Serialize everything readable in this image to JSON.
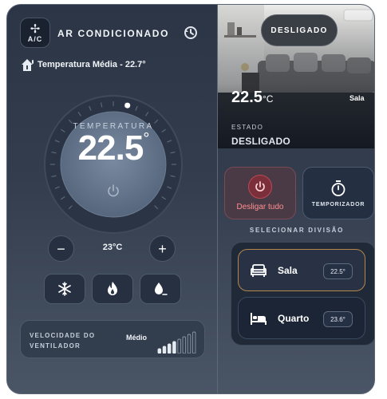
{
  "app": {
    "title": "AR CONDICIONADO",
    "logo_text": "A/C",
    "logo_icon": "fan-icon",
    "history_icon": "history-icon"
  },
  "average": {
    "text": "Temperatura Média - 22.7°",
    "icon": "home-thermometer-icon"
  },
  "dial": {
    "label": "TEMPERATURA",
    "value": "22.5",
    "unit": "°",
    "power_icon": "power-icon",
    "level_fraction": 0.55
  },
  "setpoint": {
    "decrease_label": "−",
    "value": "23°C",
    "increase_label": "+"
  },
  "modes": [
    {
      "name": "cool",
      "icon": "snowflake-icon"
    },
    {
      "name": "heat",
      "icon": "flame-icon"
    },
    {
      "name": "dry",
      "icon": "droplet-icon"
    }
  ],
  "fan": {
    "label_line1": "VELOCIDADE DO",
    "label_line2": "VENTILADOR",
    "speed": "Médio",
    "levels_total": 8,
    "levels_active": 4
  },
  "status": {
    "pill": "DESLIGADO",
    "photo_temp": "22.5",
    "photo_unit": "°C",
    "photo_room": "Sala",
    "state_label": "ESTADO",
    "state_value": "DESLIGADO"
  },
  "actions": {
    "off_all": "Desligar tudo",
    "timer": "TEMPORIZADOR"
  },
  "rooms": {
    "title": "SELECIONAR DIVISÃO",
    "items": [
      {
        "name": "Sala",
        "temp": "22.5°",
        "icon": "sofa-icon",
        "active": true
      },
      {
        "name": "Quarto",
        "temp": "23.6°",
        "icon": "bed-icon",
        "active": false
      }
    ]
  },
  "colors": {
    "accent_off": "#ff8f8f",
    "active_room_border": "#b3864a",
    "panel_bg": "#2c3545"
  }
}
